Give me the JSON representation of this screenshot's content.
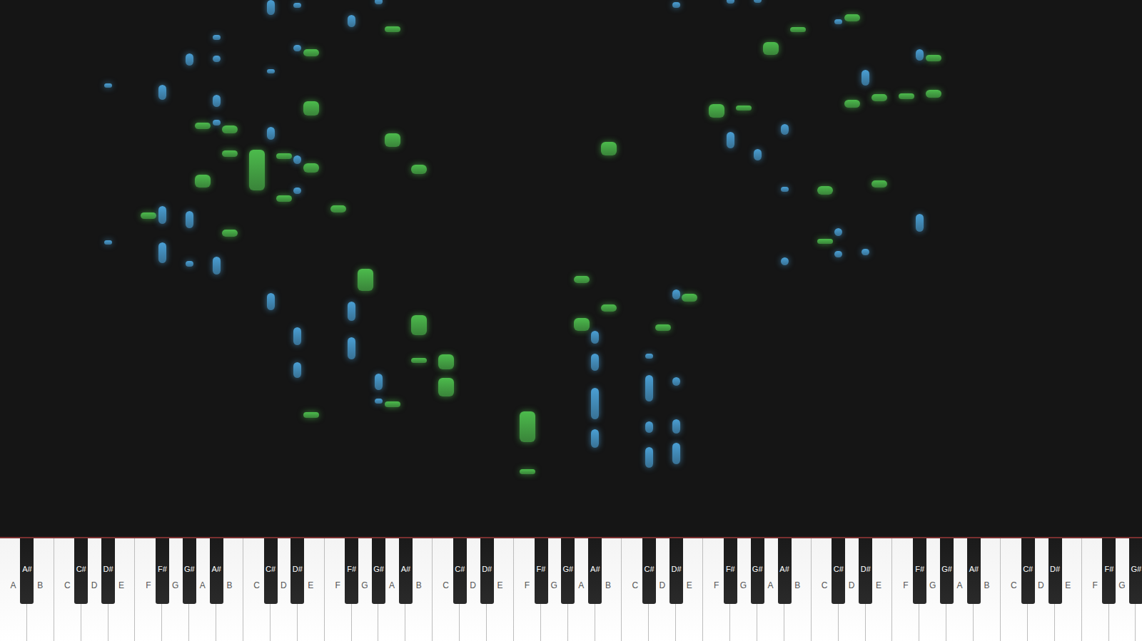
{
  "keys": [
    {
      "label": "A",
      "kind": "white"
    },
    {
      "label": "A#",
      "kind": "black"
    },
    {
      "label": "B",
      "kind": "white"
    },
    {
      "label": "C",
      "kind": "white"
    },
    {
      "label": "C#",
      "kind": "black"
    },
    {
      "label": "D",
      "kind": "white"
    },
    {
      "label": "D#",
      "kind": "black"
    },
    {
      "label": "E",
      "kind": "white"
    },
    {
      "label": "F",
      "kind": "white"
    },
    {
      "label": "F#",
      "kind": "black"
    },
    {
      "label": "G",
      "kind": "white"
    },
    {
      "label": "G#",
      "kind": "black"
    },
    {
      "label": "A",
      "kind": "white"
    },
    {
      "label": "A#",
      "kind": "black"
    },
    {
      "label": "B",
      "kind": "white"
    },
    {
      "label": "C",
      "kind": "white"
    },
    {
      "label": "C#",
      "kind": "black"
    },
    {
      "label": "D",
      "kind": "white"
    },
    {
      "label": "D#",
      "kind": "black"
    },
    {
      "label": "E",
      "kind": "white"
    },
    {
      "label": "F",
      "kind": "white"
    },
    {
      "label": "F#",
      "kind": "black"
    },
    {
      "label": "G",
      "kind": "white"
    },
    {
      "label": "G#",
      "kind": "black"
    },
    {
      "label": "A",
      "kind": "white"
    },
    {
      "label": "A#",
      "kind": "black"
    },
    {
      "label": "B",
      "kind": "white"
    },
    {
      "label": "C",
      "kind": "white"
    },
    {
      "label": "C#",
      "kind": "black"
    },
    {
      "label": "D",
      "kind": "white"
    },
    {
      "label": "D#",
      "kind": "black"
    },
    {
      "label": "E",
      "kind": "white"
    },
    {
      "label": "F",
      "kind": "white"
    },
    {
      "label": "F#",
      "kind": "black"
    },
    {
      "label": "G",
      "kind": "white"
    },
    {
      "label": "G#",
      "kind": "black"
    },
    {
      "label": "A",
      "kind": "white"
    },
    {
      "label": "A#",
      "kind": "black"
    },
    {
      "label": "B",
      "kind": "white"
    },
    {
      "label": "C",
      "kind": "white"
    },
    {
      "label": "C#",
      "kind": "black"
    },
    {
      "label": "D",
      "kind": "white"
    },
    {
      "label": "D#",
      "kind": "black"
    },
    {
      "label": "E",
      "kind": "white"
    },
    {
      "label": "F",
      "kind": "white"
    },
    {
      "label": "F#",
      "kind": "black"
    },
    {
      "label": "G",
      "kind": "white"
    },
    {
      "label": "G#",
      "kind": "black"
    },
    {
      "label": "A",
      "kind": "white"
    },
    {
      "label": "A#",
      "kind": "black"
    },
    {
      "label": "B",
      "kind": "white"
    },
    {
      "label": "C",
      "kind": "white"
    },
    {
      "label": "C#",
      "kind": "black"
    },
    {
      "label": "D",
      "kind": "white"
    },
    {
      "label": "D#",
      "kind": "black"
    },
    {
      "label": "E",
      "kind": "white"
    },
    {
      "label": "F",
      "kind": "white"
    },
    {
      "label": "F#",
      "kind": "black"
    },
    {
      "label": "G",
      "kind": "white"
    },
    {
      "label": "G#",
      "kind": "black"
    },
    {
      "label": "A",
      "kind": "white"
    },
    {
      "label": "A#",
      "kind": "black"
    },
    {
      "label": "B",
      "kind": "white"
    },
    {
      "label": "C",
      "kind": "white"
    },
    {
      "label": "C#",
      "kind": "black"
    },
    {
      "label": "D",
      "kind": "white"
    },
    {
      "label": "D#",
      "kind": "black"
    },
    {
      "label": "E",
      "kind": "white"
    },
    {
      "label": "F",
      "kind": "white"
    },
    {
      "label": "F#",
      "kind": "black"
    },
    {
      "label": "G",
      "kind": "white"
    },
    {
      "label": "G#",
      "kind": "black"
    }
  ],
  "notes": [
    {
      "key": 32,
      "start": 130,
      "duration": 43,
      "color": "#4cbb4c"
    },
    {
      "key": 32,
      "start": 86,
      "duration": 7,
      "color": "#4cbb4c"
    },
    {
      "key": 27,
      "start": 230,
      "duration": 21,
      "color": "#4cbb4c"
    },
    {
      "key": 27,
      "start": 193,
      "duration": 26,
      "color": "#4cbb4c"
    },
    {
      "key": 26,
      "start": 277,
      "duration": 28,
      "color": "#4cbb4c"
    },
    {
      "key": 26,
      "start": 239,
      "duration": 7,
      "color": "#4cbb4c"
    },
    {
      "key": 26,
      "start": 499,
      "duration": 13,
      "color": "#4cbb4c"
    },
    {
      "key": 24,
      "start": 178,
      "duration": 8,
      "color": "#4cbb4c"
    },
    {
      "key": 24,
      "start": 536,
      "duration": 19,
      "color": "#4cbb4c"
    },
    {
      "key": 24,
      "start": 694,
      "duration": 8,
      "color": "#4cbb4c"
    },
    {
      "key": 22,
      "start": 338,
      "duration": 31,
      "color": "#4cbb4c"
    },
    {
      "key": 20,
      "start": 446,
      "duration": 10,
      "color": "#4cbb4c"
    },
    {
      "key": 19,
      "start": 164,
      "duration": 8,
      "color": "#4cbb4c"
    },
    {
      "key": 19,
      "start": 501,
      "duration": 13,
      "color": "#4cbb4c"
    },
    {
      "key": 19,
      "start": 579,
      "duration": 20,
      "color": "#4cbb4c"
    },
    {
      "key": 19,
      "start": 661,
      "duration": 10,
      "color": "#4cbb4c"
    },
    {
      "key": 17,
      "start": 520,
      "duration": 7,
      "color": "#4cbb4c"
    },
    {
      "key": 17,
      "start": 461,
      "duration": 9,
      "color": "#4cbb4c"
    },
    {
      "key": 15,
      "start": 476,
      "duration": 56,
      "color": "#4cbb4c"
    },
    {
      "key": 14,
      "start": 555,
      "duration": 11,
      "color": "#4cbb4c"
    },
    {
      "key": 14,
      "start": 523,
      "duration": 8,
      "color": "#4cbb4c"
    },
    {
      "key": 14,
      "start": 413,
      "duration": 10,
      "color": "#4cbb4c"
    },
    {
      "key": 12,
      "start": 561,
      "duration": 9,
      "color": "#4cbb4c"
    },
    {
      "key": 12,
      "start": 480,
      "duration": 18,
      "color": "#4cbb4c"
    },
    {
      "key": 8,
      "start": 437,
      "duration": 9,
      "color": "#4cbb4c"
    },
    {
      "key": 36,
      "start": 349,
      "duration": 10,
      "color": "#4cbb4c"
    },
    {
      "key": 36,
      "start": 283,
      "duration": 18,
      "color": "#4cbb4c"
    },
    {
      "key": 38,
      "start": 310,
      "duration": 10,
      "color": "#4cbb4c"
    },
    {
      "key": 38,
      "start": 525,
      "duration": 18,
      "color": "#4cbb4c"
    },
    {
      "key": 41,
      "start": 283,
      "duration": 9,
      "color": "#4cbb4c"
    },
    {
      "key": 43,
      "start": 324,
      "duration": 10,
      "color": "#4cbb4c"
    },
    {
      "key": 44,
      "start": 576,
      "duration": 19,
      "color": "#4cbb4c"
    },
    {
      "key": 46,
      "start": 586,
      "duration": 7,
      "color": "#4cbb4c"
    },
    {
      "key": 48,
      "start": 663,
      "duration": 17,
      "color": "#4cbb4c"
    },
    {
      "key": 50,
      "start": 694,
      "duration": 7,
      "color": "#4cbb4c"
    },
    {
      "key": 51,
      "start": 471,
      "duration": 11,
      "color": "#4cbb4c"
    },
    {
      "key": 51,
      "start": 403,
      "duration": 7,
      "color": "#4cbb4c"
    },
    {
      "key": 53,
      "start": 709,
      "duration": 10,
      "color": "#4cbb4c"
    },
    {
      "key": 53,
      "start": 590,
      "duration": 11,
      "color": "#4cbb4c"
    },
    {
      "key": 55,
      "start": 599,
      "duration": 10,
      "color": "#4cbb4c"
    },
    {
      "key": 55,
      "start": 480,
      "duration": 10,
      "color": "#4cbb4c"
    },
    {
      "key": 56,
      "start": 602,
      "duration": 8,
      "color": "#4cbb4c"
    },
    {
      "key": 58,
      "start": 654,
      "duration": 9,
      "color": "#4cbb4c"
    },
    {
      "key": 58,
      "start": 604,
      "duration": 11,
      "color": "#4cbb4c"
    },
    {
      "key": 6,
      "start": 618,
      "duration": 6,
      "color": "#4a9fd4"
    },
    {
      "key": 6,
      "start": 402,
      "duration": 6,
      "color": "#4a9fd4"
    },
    {
      "key": 9,
      "start": 601,
      "duration": 21,
      "color": "#4a9fd4"
    },
    {
      "key": 9,
      "start": 430,
      "duration": 25,
      "color": "#4a9fd4"
    },
    {
      "key": 9,
      "start": 376,
      "duration": 29,
      "color": "#4a9fd4"
    },
    {
      "key": 11,
      "start": 648,
      "duration": 17,
      "color": "#4a9fd4"
    },
    {
      "key": 11,
      "start": 425,
      "duration": 23,
      "color": "#4a9fd4"
    },
    {
      "key": 11,
      "start": 372,
      "duration": 7,
      "color": "#4a9fd4"
    },
    {
      "key": 13,
      "start": 683,
      "duration": 7,
      "color": "#4a9fd4"
    },
    {
      "key": 13,
      "start": 653,
      "duration": 9,
      "color": "#4a9fd4"
    },
    {
      "key": 13,
      "start": 591,
      "duration": 17,
      "color": "#4a9fd4"
    },
    {
      "key": 13,
      "start": 566,
      "duration": 8,
      "color": "#4a9fd4"
    },
    {
      "key": 13,
      "start": 361,
      "duration": 24,
      "color": "#4a9fd4"
    },
    {
      "key": 16,
      "start": 718,
      "duration": 20,
      "color": "#4a9fd4"
    },
    {
      "key": 16,
      "start": 637,
      "duration": 6,
      "color": "#4a9fd4"
    },
    {
      "key": 16,
      "start": 546,
      "duration": 18,
      "color": "#4a9fd4"
    },
    {
      "key": 16,
      "start": 312,
      "duration": 23,
      "color": "#4a9fd4"
    },
    {
      "key": 18,
      "start": 727,
      "duration": 7,
      "color": "#4a9fd4"
    },
    {
      "key": 18,
      "start": 668,
      "duration": 8,
      "color": "#4a9fd4"
    },
    {
      "key": 18,
      "start": 513,
      "duration": 12,
      "color": "#4a9fd4"
    },
    {
      "key": 18,
      "start": 472,
      "duration": 8,
      "color": "#4a9fd4"
    },
    {
      "key": 18,
      "start": 264,
      "duration": 24,
      "color": "#4a9fd4"
    },
    {
      "key": 18,
      "start": 219,
      "duration": 21,
      "color": "#4a9fd4"
    },
    {
      "key": 21,
      "start": 701,
      "duration": 17,
      "color": "#4a9fd4"
    },
    {
      "key": 21,
      "start": 297,
      "duration": 27,
      "color": "#4a9fd4"
    },
    {
      "key": 21,
      "start": 244,
      "duration": 31,
      "color": "#4a9fd4"
    },
    {
      "key": 23,
      "start": 732,
      "duration": 8,
      "color": "#4a9fd4"
    },
    {
      "key": 23,
      "start": 202,
      "duration": 23,
      "color": "#4a9fd4"
    },
    {
      "key": 23,
      "start": 183,
      "duration": 7,
      "color": "#4a9fd4"
    },
    {
      "key": 37,
      "start": 266,
      "duration": 17,
      "color": "#4a9fd4"
    },
    {
      "key": 37,
      "start": 228,
      "duration": 24,
      "color": "#4a9fd4"
    },
    {
      "key": 37,
      "start": 162,
      "duration": 43,
      "color": "#4a9fd4"
    },
    {
      "key": 37,
      "start": 123,
      "duration": 25,
      "color": "#4a9fd4"
    },
    {
      "key": 40,
      "start": 245,
      "duration": 7,
      "color": "#4a9fd4"
    },
    {
      "key": 40,
      "start": 186,
      "duration": 37,
      "color": "#4a9fd4"
    },
    {
      "key": 40,
      "start": 143,
      "duration": 16,
      "color": "#4a9fd4"
    },
    {
      "key": 40,
      "start": 95,
      "duration": 29,
      "color": "#4a9fd4"
    },
    {
      "key": 42,
      "start": 727,
      "duration": 8,
      "color": "#4a9fd4"
    },
    {
      "key": 42,
      "start": 326,
      "duration": 14,
      "color": "#4a9fd4"
    },
    {
      "key": 42,
      "start": 208,
      "duration": 12,
      "color": "#4a9fd4"
    },
    {
      "key": 42,
      "start": 142,
      "duration": 20,
      "color": "#4a9fd4"
    },
    {
      "key": 42,
      "start": 100,
      "duration": 29,
      "color": "#4a9fd4"
    },
    {
      "key": 45,
      "start": 733,
      "duration": 8,
      "color": "#4a9fd4"
    },
    {
      "key": 45,
      "start": 534,
      "duration": 23,
      "color": "#4a9fd4"
    },
    {
      "key": 47,
      "start": 734,
      "duration": 8,
      "color": "#4a9fd4"
    },
    {
      "key": 47,
      "start": 518,
      "duration": 15,
      "color": "#4a9fd4"
    },
    {
      "key": 49,
      "start": 553,
      "duration": 15,
      "color": "#4a9fd4"
    },
    {
      "key": 49,
      "start": 475,
      "duration": 6,
      "color": "#4a9fd4"
    },
    {
      "key": 49,
      "start": 374,
      "duration": 10,
      "color": "#4a9fd4"
    },
    {
      "key": 52,
      "start": 705,
      "duration": 7,
      "color": "#4a9fd4"
    },
    {
      "key": 52,
      "start": 414,
      "duration": 11,
      "color": "#4a9fd4"
    },
    {
      "key": 52,
      "start": 384,
      "duration": 9,
      "color": "#4a9fd4"
    },
    {
      "key": 54,
      "start": 621,
      "duration": 21,
      "color": "#4a9fd4"
    },
    {
      "key": 54,
      "start": 387,
      "duration": 9,
      "color": "#4a9fd4"
    },
    {
      "key": 57,
      "start": 655,
      "duration": 16,
      "color": "#4a9fd4"
    },
    {
      "key": 57,
      "start": 420,
      "duration": 24,
      "color": "#4a9fd4"
    }
  ]
}
